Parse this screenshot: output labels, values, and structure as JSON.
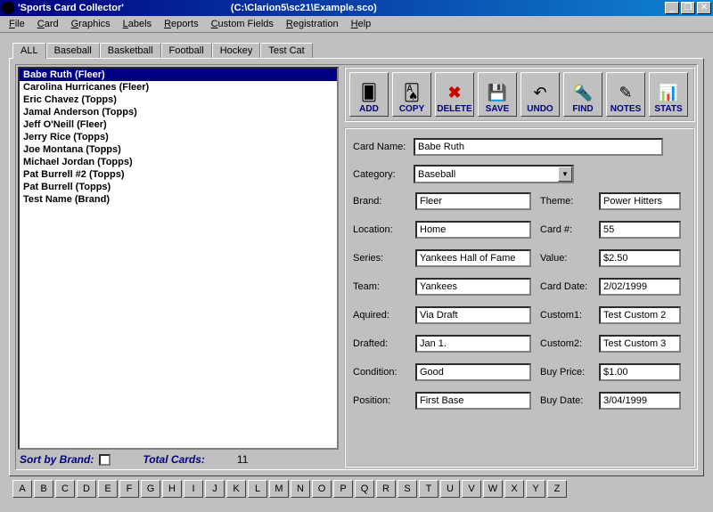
{
  "titlebar": {
    "app": "'Sports Card Collector'",
    "path": "(C:\\Clarion5\\sc21\\Example.sco)"
  },
  "menu": [
    "File",
    "Card",
    "Graphics",
    "Labels",
    "Reports",
    "Custom Fields",
    "Registration",
    "Help"
  ],
  "tabs": [
    "ALL",
    "Baseball",
    "Basketball",
    "Football",
    "Hockey",
    "Test Cat"
  ],
  "list": [
    "Babe Ruth (Fleer)",
    "Carolina Hurricanes (Fleer)",
    "Eric Chavez (Topps)",
    "Jamal Anderson (Topps)",
    "Jeff O'Neill (Fleer)",
    "Jerry Rice (Topps)",
    "Joe Montana (Topps)",
    "Michael Jordan (Topps)",
    "Pat Burrell #2 (Topps)",
    "Pat Burrell (Topps)",
    "Test Name (Brand)"
  ],
  "sort": {
    "label": "Sort by Brand:",
    "total_label": "Total Cards:",
    "total": "11"
  },
  "toolbar": [
    {
      "name": "add",
      "label": "ADD",
      "glyph": "🂠"
    },
    {
      "name": "copy",
      "label": "COPY",
      "glyph": "🂡"
    },
    {
      "name": "delete",
      "label": "DELETE",
      "glyph": "✖",
      "color": "#c00"
    },
    {
      "name": "save",
      "label": "SAVE",
      "glyph": "💾",
      "color": "#0a0"
    },
    {
      "name": "undo",
      "label": "UNDO",
      "glyph": "↶"
    },
    {
      "name": "find",
      "label": "FIND",
      "glyph": "🔦"
    },
    {
      "name": "notes",
      "label": "NOTES",
      "glyph": "✎"
    },
    {
      "name": "stats",
      "label": "STATS",
      "glyph": "📊"
    }
  ],
  "form": {
    "card_name_label": "Card Name:",
    "card_name": "Babe Ruth",
    "category_label": "Category:",
    "category": "Baseball",
    "brand_label": "Brand:",
    "brand": "Fleer",
    "theme_label": "Theme:",
    "theme": "Power Hitters",
    "location_label": "Location:",
    "location": "Home",
    "cardno_label": "Card #:",
    "cardno": "55",
    "series_label": "Series:",
    "series": "Yankees Hall of Fame",
    "value_label": "Value:",
    "value": "$2.50",
    "team_label": "Team:",
    "team": "Yankees",
    "carddate_label": "Card Date:",
    "carddate": "2/02/1999",
    "aquired_label": "Aquired:",
    "aquired": "Via Draft",
    "custom1_label": "Custom1:",
    "custom1": "Test Custom 2",
    "drafted_label": "Drafted:",
    "drafted": "Jan 1.",
    "custom2_label": "Custom2:",
    "custom2": "Test Custom 3",
    "condition_label": "Condition:",
    "condition": "Good",
    "buyprice_label": "Buy Price:",
    "buyprice": "$1.00",
    "position_label": "Position:",
    "position": "First Base",
    "buydate_label": "Buy Date:",
    "buydate": "3/04/1999"
  },
  "alpha": [
    "A",
    "B",
    "C",
    "D",
    "E",
    "F",
    "G",
    "H",
    "I",
    "J",
    "K",
    "L",
    "M",
    "N",
    "O",
    "P",
    "Q",
    "R",
    "S",
    "T",
    "U",
    "V",
    "W",
    "X",
    "Y",
    "Z"
  ]
}
